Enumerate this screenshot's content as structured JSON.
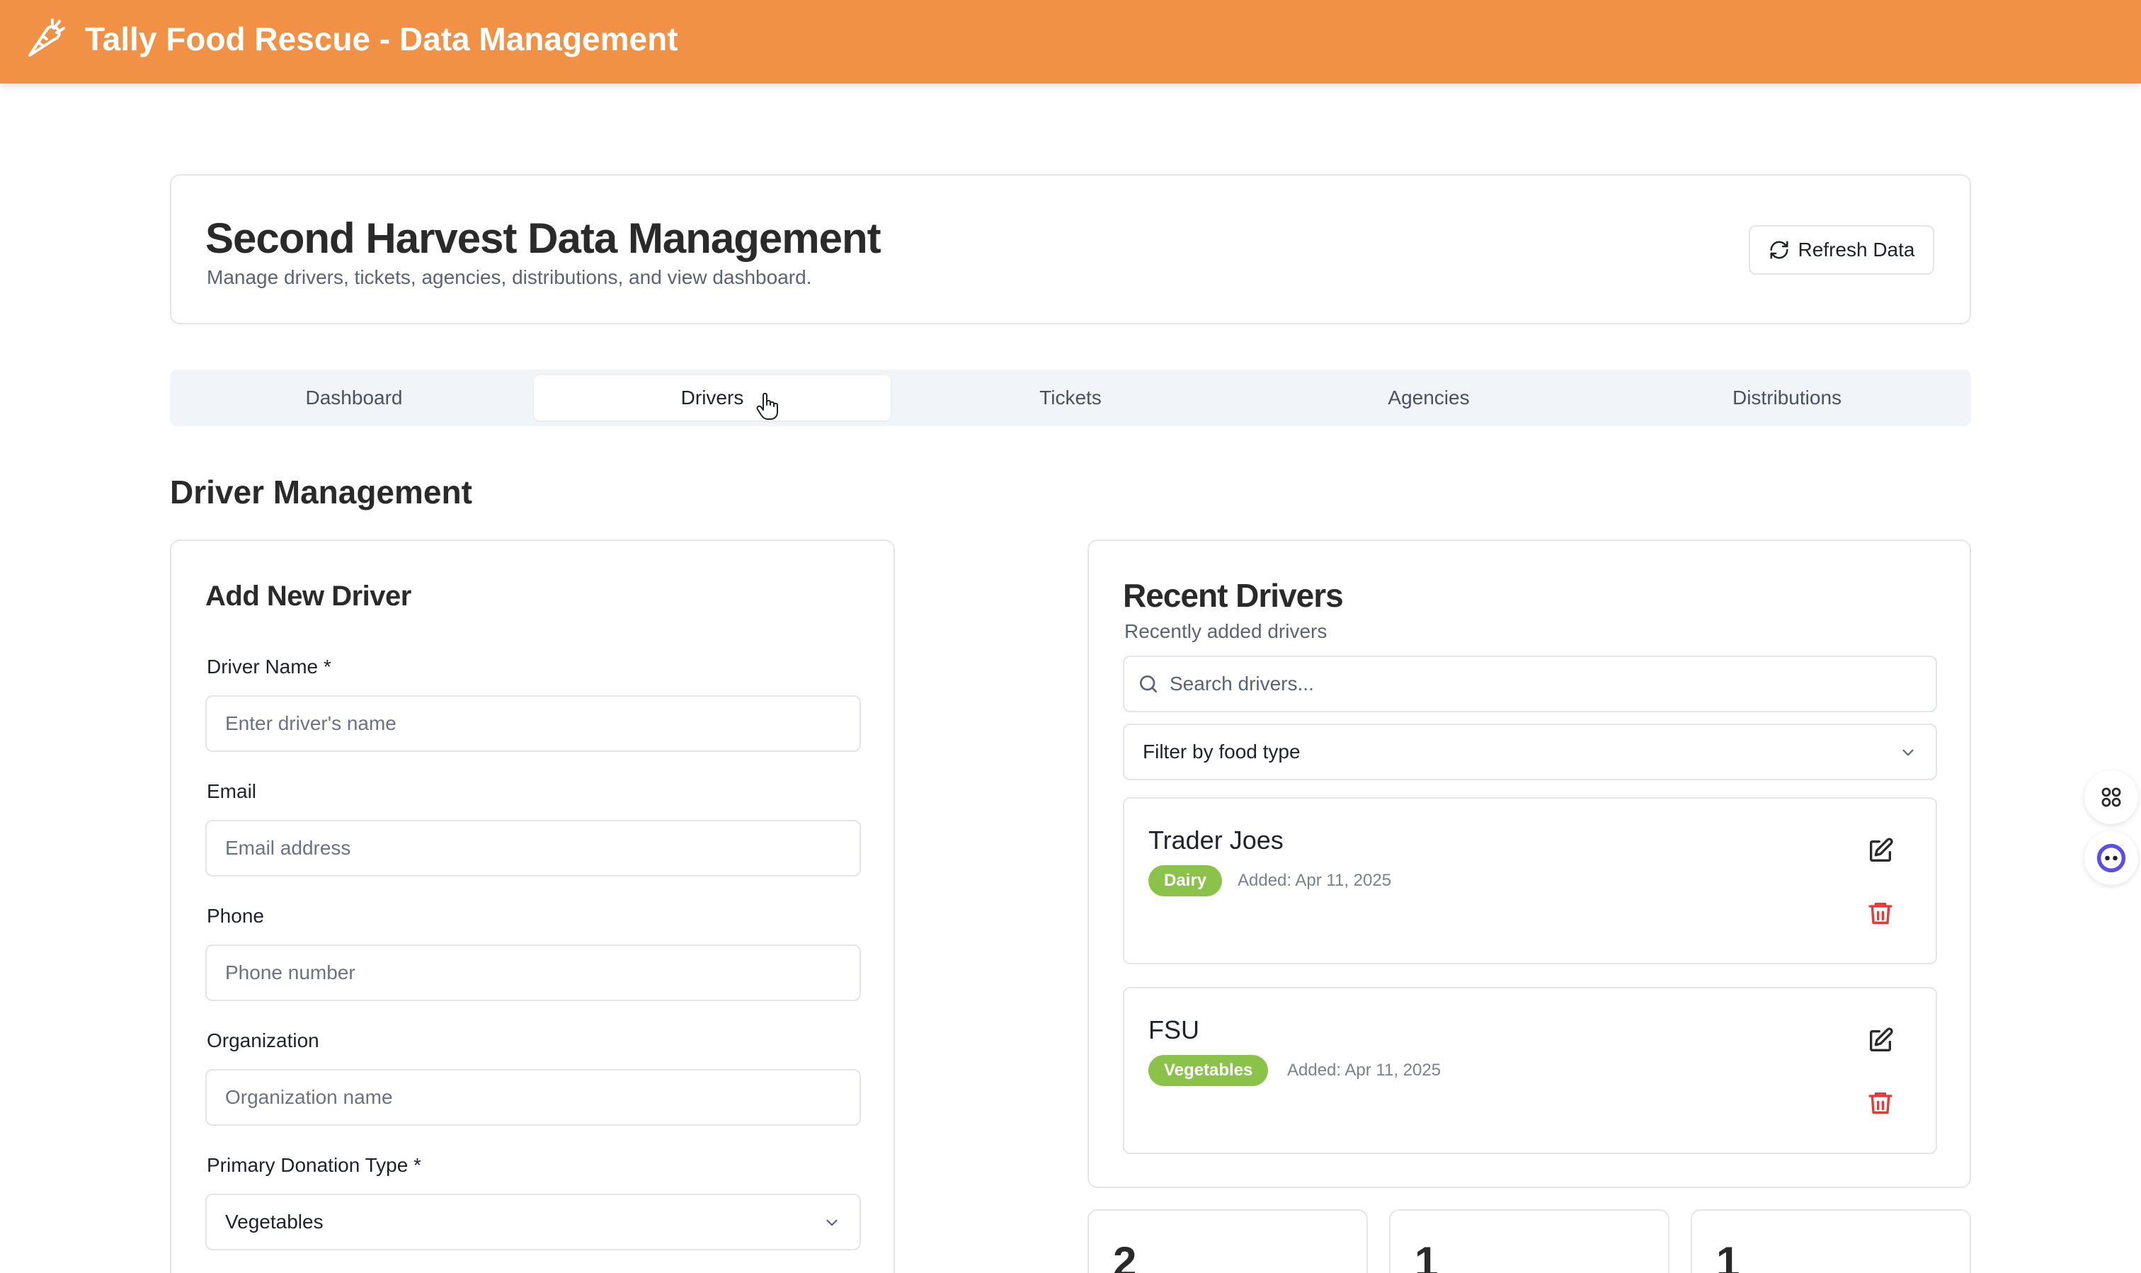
{
  "app": {
    "title": "Tally Food Rescue - Data Management",
    "accent_color": "#f09145",
    "logo_icon": "carrot-icon"
  },
  "header": {
    "title": "Second Harvest Data Management",
    "subtitle": "Manage drivers, tickets, agencies, distributions, and view dashboard.",
    "refresh_label": "Refresh Data"
  },
  "tabs": [
    {
      "label": "Dashboard",
      "active": false
    },
    {
      "label": "Drivers",
      "active": true
    },
    {
      "label": "Tickets",
      "active": false
    },
    {
      "label": "Agencies",
      "active": false
    },
    {
      "label": "Distributions",
      "active": false
    }
  ],
  "section_title": "Driver Management",
  "form": {
    "title": "Add New Driver",
    "fields": [
      {
        "label": "Driver Name *",
        "placeholder": "Enter driver's name"
      },
      {
        "label": "Email",
        "placeholder": "Email address"
      },
      {
        "label": "Phone",
        "placeholder": "Phone number"
      },
      {
        "label": "Organization",
        "placeholder": "Organization name"
      }
    ],
    "donation_type": {
      "label": "Primary Donation Type *",
      "value": "Vegetables"
    }
  },
  "recent": {
    "title": "Recent Drivers",
    "subtitle": "Recently added drivers",
    "search_placeholder": "Search drivers...",
    "filter_label": "Filter by food type",
    "badge_color": "#8bc34a",
    "delete_color": "#e53935",
    "drivers": [
      {
        "name": "Trader Joes",
        "food_type": "Dairy",
        "added": "Added: Apr 11, 2025"
      },
      {
        "name": "FSU",
        "food_type": "Vegetables",
        "added": "Added: Apr 11, 2025"
      }
    ]
  },
  "stats": [
    {
      "value": "2"
    },
    {
      "value": "1"
    },
    {
      "value": "1"
    }
  ]
}
